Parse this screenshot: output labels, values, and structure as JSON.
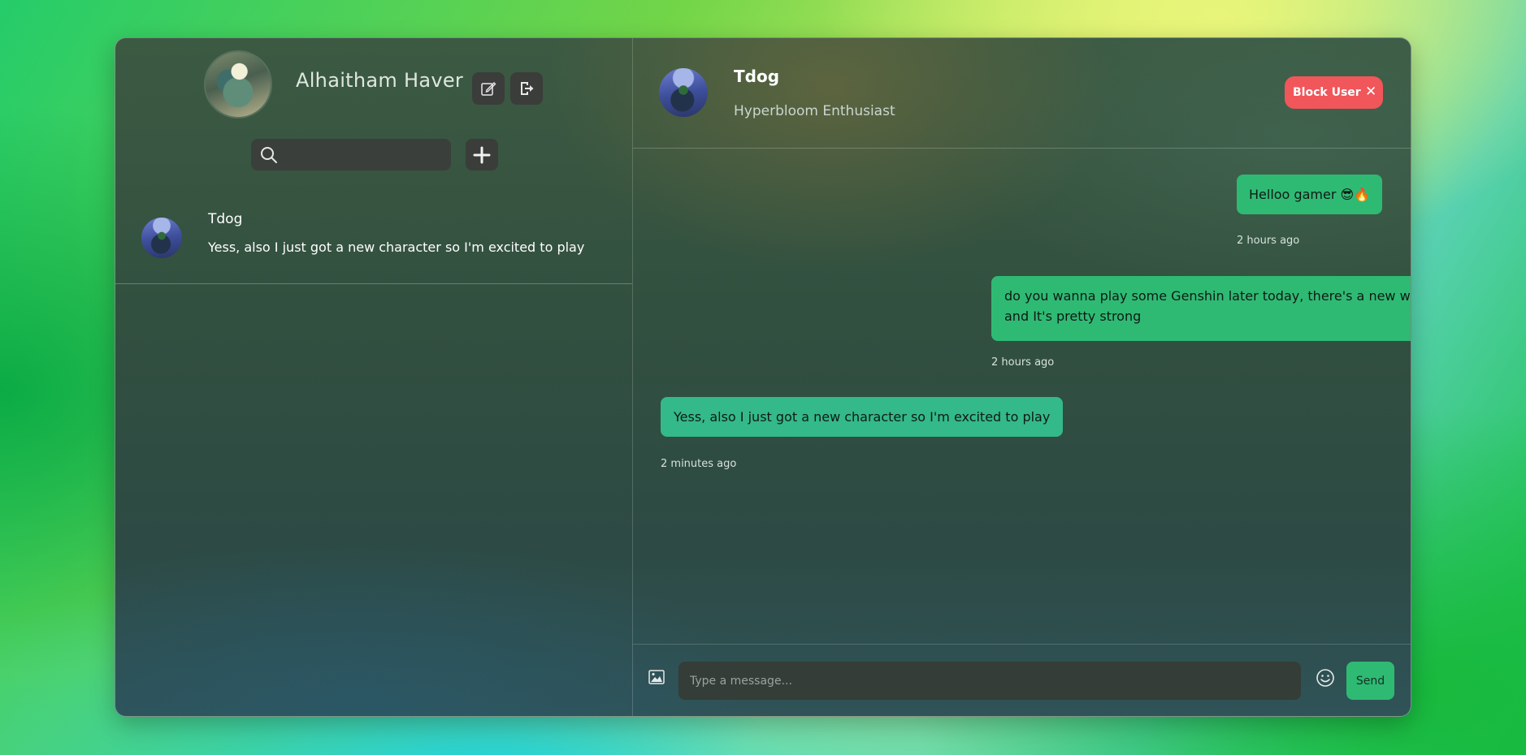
{
  "sidebar": {
    "user": {
      "name": "Alhaitham Haver",
      "avatar": "user-avatar"
    },
    "actions": {
      "edit_icon": "edit-icon",
      "logout_icon": "logout-icon"
    },
    "search": {
      "placeholder": "",
      "icon": "search-icon"
    },
    "add_icon": "plus-icon",
    "chats": [
      {
        "name": "Tdog",
        "preview": "Yess, also I just got a new character so I'm excited to play"
      }
    ]
  },
  "chat": {
    "header": {
      "name": "Tdog",
      "status": "Hyperbloom Enthusiast"
    },
    "block_button": {
      "label": "Block User",
      "close": "✕"
    },
    "messages": [
      {
        "type": "sent",
        "text": "Helloo gamer 😎🔥",
        "time": "2 hours ago"
      },
      {
        "type": "sent",
        "text": "do you wanna play some Genshin later today, there's a new world boss and It's pretty strong",
        "time": "2 hours ago"
      },
      {
        "type": "received",
        "text": "Yess, also I just got a new character so I'm excited to play",
        "time": "2 minutes ago"
      }
    ],
    "composer": {
      "placeholder": "Type a message...",
      "send_label": "Send",
      "image_icon": "image-icon",
      "emoji_icon": "emoji-icon"
    }
  },
  "colors": {
    "accent_green": "#2fba74",
    "block_red": "#f0565a"
  }
}
